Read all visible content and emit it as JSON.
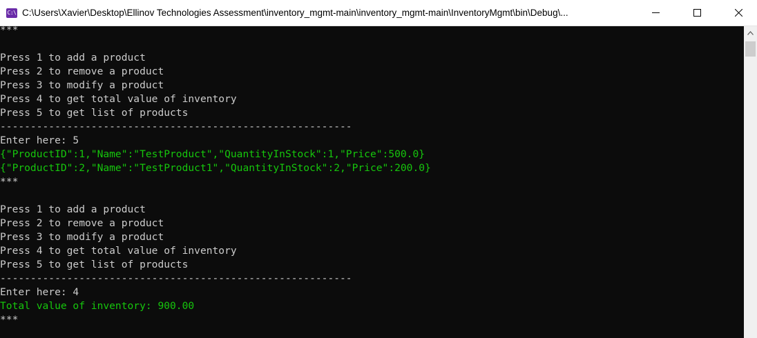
{
  "window": {
    "title": "C:\\Users\\Xavier\\Desktop\\Ellinov Technologies Assessment\\inventory_mgmt-main\\inventory_mgmt-main\\InventoryMgmt\\bin\\Debug\\...",
    "app_icon_text": "C:\\"
  },
  "console": {
    "lines": [
      {
        "text": "***",
        "color": "#cccccc"
      },
      {
        "text": "",
        "color": "#cccccc"
      },
      {
        "text": "Press 1 to add a product",
        "color": "#cccccc"
      },
      {
        "text": "Press 2 to remove a product",
        "color": "#cccccc"
      },
      {
        "text": "Press 3 to modify a product",
        "color": "#cccccc"
      },
      {
        "text": "Press 4 to get total value of inventory",
        "color": "#cccccc"
      },
      {
        "text": "Press 5 to get list of products",
        "color": "#cccccc"
      },
      {
        "text": "----------------------------------------------------------",
        "color": "#cccccc"
      },
      {
        "text": "Enter here: 5",
        "color": "#cccccc"
      },
      {
        "text": "{\"ProductID\":1,\"Name\":\"TestProduct\",\"QuantityInStock\":1,\"Price\":500.0}",
        "color": "#16c60c"
      },
      {
        "text": "{\"ProductID\":2,\"Name\":\"TestProduct1\",\"QuantityInStock\":2,\"Price\":200.0}",
        "color": "#16c60c"
      },
      {
        "text": "***",
        "color": "#cccccc"
      },
      {
        "text": "",
        "color": "#cccccc"
      },
      {
        "text": "Press 1 to add a product",
        "color": "#cccccc"
      },
      {
        "text": "Press 2 to remove a product",
        "color": "#cccccc"
      },
      {
        "text": "Press 3 to modify a product",
        "color": "#cccccc"
      },
      {
        "text": "Press 4 to get total value of inventory",
        "color": "#cccccc"
      },
      {
        "text": "Press 5 to get list of products",
        "color": "#cccccc"
      },
      {
        "text": "----------------------------------------------------------",
        "color": "#cccccc"
      },
      {
        "text": "Enter here: 4",
        "color": "#cccccc"
      },
      {
        "text": "Total value of inventory: 900.00",
        "color": "#16c60c"
      },
      {
        "text": "***",
        "color": "#cccccc"
      }
    ]
  },
  "icons": {
    "minimize": "minimize-icon",
    "maximize": "maximize-icon",
    "close": "close-icon",
    "scroll_up": "scroll-up-arrow-icon"
  }
}
